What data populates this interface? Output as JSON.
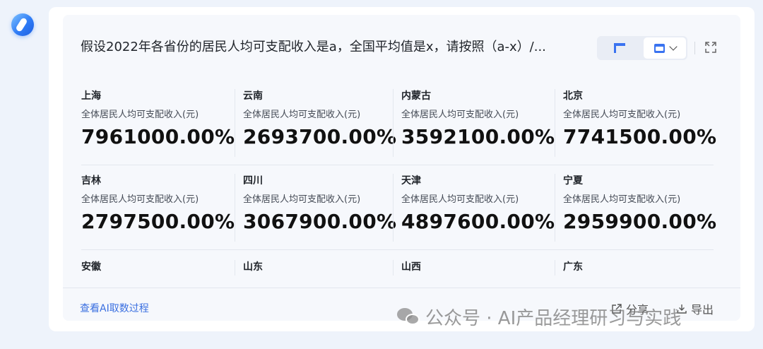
{
  "question": "假设2022年各省份的居民人均可支配收入是a，全国平均值是x，请按照（a-x）/...",
  "toolbar": {
    "table_icon": "table-icon",
    "chart_icon": "calendar-chart-icon",
    "dropdown_icon": "chevron-down-icon",
    "expand_icon": "expand-icon"
  },
  "metric_label": "全体居民人均可支配收入(元)",
  "rows": [
    [
      {
        "name": "上海",
        "value": "7961000.00%"
      },
      {
        "name": "云南",
        "value": "2693700.00%"
      },
      {
        "name": "内蒙古",
        "value": "3592100.00%"
      },
      {
        "name": "北京",
        "value": "7741500.00%"
      }
    ],
    [
      {
        "name": "吉林",
        "value": "2797500.00%"
      },
      {
        "name": "四川",
        "value": "3067900.00%"
      },
      {
        "name": "天津",
        "value": "4897600.00%"
      },
      {
        "name": "宁夏",
        "value": "2959900.00%"
      }
    ],
    [
      {
        "name": "安徽"
      },
      {
        "name": "山东"
      },
      {
        "name": "山西"
      },
      {
        "name": "广东"
      }
    ]
  ],
  "footer": {
    "ai_link": "查看AI取数过程",
    "share": "分享",
    "export": "导出"
  },
  "watermark": "公众号 · AI产品经理研习与实践",
  "colors": {
    "accent": "#3a73f0",
    "link": "#3a6fe0"
  }
}
